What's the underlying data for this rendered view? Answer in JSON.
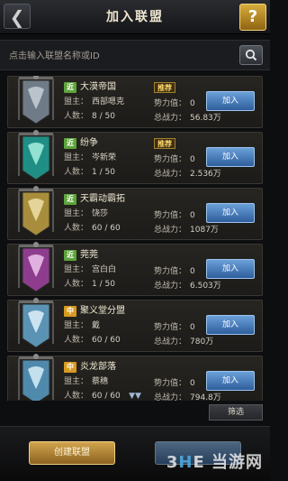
{
  "header": {
    "title": "加入联盟",
    "help_label": "?",
    "back_icon": "back-arrow-icon"
  },
  "search": {
    "placeholder": "点击输入联盟名称或ID"
  },
  "labels": {
    "leader": "盟主：",
    "members": "人数：",
    "power_value": "势力值：",
    "total_power": "总战力：",
    "recommend": "推荐",
    "join": "加入"
  },
  "guilds": [
    {
      "tag": "近",
      "tag_kind": "near",
      "name": "大漠帝国",
      "leader": "西部嗯克",
      "members": "8 / 50",
      "power": "0",
      "total": "56.83万",
      "recommended": true,
      "banner_color": "#6f7b86",
      "emblem_color": "#c8d0d8"
    },
    {
      "tag": "近",
      "tag_kind": "near",
      "name": "纷争",
      "leader": "岑新荣",
      "members": "1 / 50",
      "power": "0",
      "total": "2.536万",
      "recommended": true,
      "banner_color": "#1f8f86",
      "emblem_color": "#a8f0df"
    },
    {
      "tag": "近",
      "tag_kind": "near",
      "name": "天霸动霸拓",
      "leader": "饶莎",
      "members": "60 / 60",
      "power": "0",
      "total": "1087万",
      "recommended": false,
      "banner_color": "#a88e3c",
      "emblem_color": "#efe0a8"
    },
    {
      "tag": "近",
      "tag_kind": "near",
      "name": "莞莞",
      "leader": "宫白白",
      "members": "1 / 50",
      "power": "0",
      "total": "6.503万",
      "recommended": false,
      "banner_color": "#8e3d8e",
      "emblem_color": "#efc5ef"
    },
    {
      "tag": "中",
      "tag_kind": "mid",
      "name": "聚义堂分盟",
      "leader": "戴",
      "members": "60 / 60",
      "power": "0",
      "total": "780万",
      "recommended": false,
      "banner_color": "#5a93b4",
      "emblem_color": "#e0f2fb"
    },
    {
      "tag": "中",
      "tag_kind": "mid",
      "name": "炎龙部落",
      "leader": "蔡穗",
      "members": "60 / 60",
      "power": "0",
      "total": "794.8万",
      "recommended": false,
      "banner_color": "#4f8aac",
      "emblem_color": "#d8eef8"
    }
  ],
  "footer": {
    "filter_label": "筛选",
    "create_label": "创建联盟",
    "more_icon": "chevron-down-icon",
    "blue_button_label": "",
    "watermark": "当游网"
  },
  "colors": {
    "join_button": "#3f6ea9",
    "create_button": "#b0822f",
    "near_tag": "#5ea33b",
    "mid_tag": "#d79a21",
    "recommend_tag": "#ffd668"
  }
}
